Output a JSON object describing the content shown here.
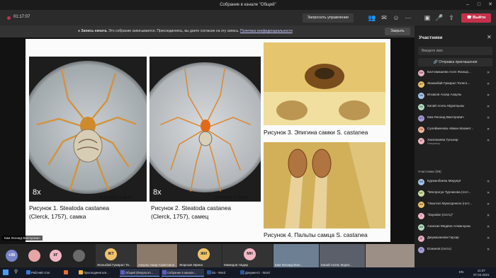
{
  "window": {
    "title": "Собрание в канале \"Общий\""
  },
  "toolbar": {
    "timer": "01:17:07",
    "request_control": "Запросить управление",
    "leave": "Выйти"
  },
  "banner": {
    "prefix": "Запись начата.",
    "text": "Это собрание записывается. Присоединяясь, вы даете согласие на эту запись.",
    "link": "Политика конфиденциальности",
    "close": "Закрыть"
  },
  "slide": {
    "fig1": {
      "mag": "8x",
      "stamp": "16.03.2021 16:45:43",
      "caption_line1": "Рисунок 1. Steatoda castanea",
      "caption_line2": "(Clerck, 1757), самка"
    },
    "fig2": {
      "mag": "8x",
      "stamp": "16.03.2021 17:33:59",
      "caption_line1": "Рисунок 2. Steatoda castanea",
      "caption_line2": "(Clerck, 1757), самец"
    },
    "fig3": {
      "caption": "Рисунок 3. Эпигина самки S. castanea"
    },
    "fig4": {
      "caption": "Рисунок 4. Пальпы самца S. castanea"
    }
  },
  "stage": {
    "speaker_name": "Ким Леонид Викторович"
  },
  "strip": {
    "more": "+35",
    "circles": [
      {
        "initials": "",
        "color": "#e8a5a5"
      },
      {
        "initials": "ХГ",
        "color": "#f3b6c4"
      }
    ],
    "tiles": [
      {
        "name": "Жаныбай Гумарал Те..",
        "initials": "ЖТ",
        "color": "#f0c36a"
      },
      {
        "name": "Азкулы Ажар Ахметовна",
        "initials": "",
        "color": "#8b7a6a"
      },
      {
        "name": "Жарская Ирина",
        "initials": "ЖИ",
        "color": "#f0c36a"
      },
      {
        "name": "Мамедов Надир",
        "initials": "МН",
        "color": "#f3b6c4"
      },
      {
        "name": "Ким Леонид Викт...",
        "initials": "",
        "color": "#6d7f92"
      },
      {
        "name": "Капай Асель Мурат...",
        "initials": "",
        "color": "#5a5f6a"
      },
      {
        "name": "",
        "initials": "",
        "color": "#9c8f86"
      }
    ]
  },
  "panel": {
    "title": "Участники",
    "search_placeholder": "Введите имя",
    "share_invite": "Отправка приглашения",
    "section_label": "Участники (58)",
    "top_list": [
      {
        "name": "Балтамашева Асел Жаныр...",
        "initials": "БЖ",
        "color": "#e9b3c2",
        "sub": ""
      },
      {
        "name": "Жанкибай Гумарал Толего...",
        "initials": "ЖТ",
        "color": "#f0c36a",
        "sub": ""
      },
      {
        "name": "Искаков Аскар Азаулы",
        "initials": "ИА",
        "color": "#a5c4ea",
        "sub": ""
      },
      {
        "name": "Капай Асель Муратқызы",
        "initials": "КА",
        "color": "#b3dcc0",
        "sub": ""
      },
      {
        "name": "Ким Леонид Викторович",
        "initials": "КЛ",
        "color": "#a79ad6",
        "sub": ""
      },
      {
        "name": "Сулейменова Айжан Махмет...",
        "initials": "СА",
        "color": "#f2b29a",
        "sub": ""
      },
      {
        "name": "Хасенкаева Гульнар",
        "initials": "ХГ",
        "color": "#f3b6c4",
        "sub": "Инициатор"
      }
    ],
    "list": [
      {
        "name": "Курманбаева Меруерт",
        "initials": "КМ",
        "color": "#a5c4ea"
      },
      {
        "name": "\"\\Молрнгуа Турликова (гост...",
        "initials": "МТ",
        "color": "#cde0a0"
      },
      {
        "name": "\"Нашталі Мукатденкон (гост...",
        "initials": "НМ",
        "color": "#f0c36a"
      },
      {
        "name": "\"Zayadan (гость)\"",
        "initials": "Z",
        "color": "#f3b6c4"
      },
      {
        "name": "Азанхан Медина Алмасқызы",
        "initials": "АМ",
        "color": "#b3dcc0"
      },
      {
        "name": "Джумаханова Гаухар",
        "initials": "ДГ",
        "color": "#e9b3c2"
      },
      {
        "name": "Есжанов (гость)",
        "initials": "Е",
        "color": "#a79ad6"
      }
    ]
  },
  "taskbar": {
    "apps": [
      {
        "label": "Рабочий стол",
        "color": "#3a7bd5",
        "active": false
      },
      {
        "label": "",
        "color": "#e86e2c",
        "active": false
      },
      {
        "label": "Присоединиться...",
        "color": "#f3b33d",
        "active": false
      },
      {
        "label": "Общий (Факультет...",
        "color": "#5b5fc7",
        "active": true
      },
      {
        "label": "Собрание в канале...",
        "color": "#5b5fc7",
        "active": true
      },
      {
        "label": "Do - Word",
        "color": "#2b579a",
        "active": false
      },
      {
        "label": "Документ1 - Word",
        "color": "#2b579a",
        "active": false
      }
    ],
    "lang": "EN",
    "time": "11:37",
    "date": "07.04.2021"
  }
}
